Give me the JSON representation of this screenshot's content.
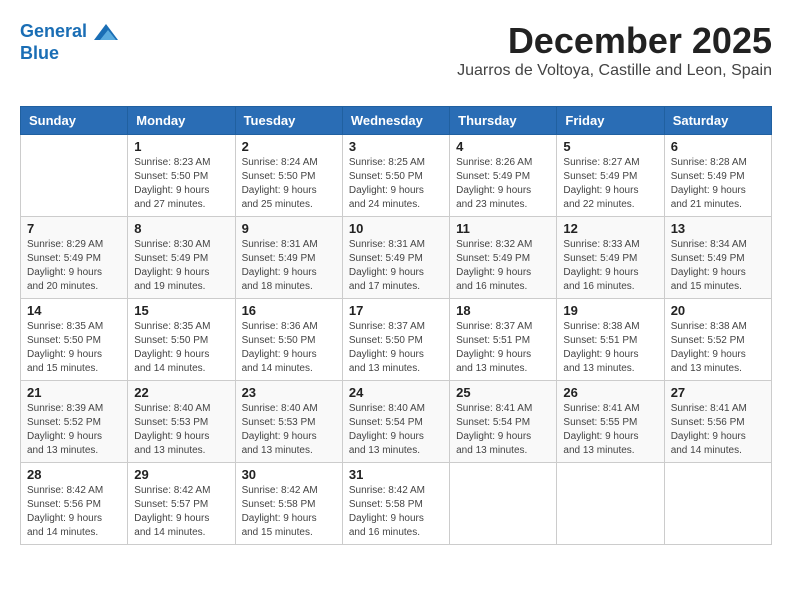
{
  "header": {
    "logo_line1": "General",
    "logo_line2": "Blue",
    "month_title": "December 2025",
    "subtitle": "Juarros de Voltoya, Castille and Leon, Spain"
  },
  "weekdays": [
    "Sunday",
    "Monday",
    "Tuesday",
    "Wednesday",
    "Thursday",
    "Friday",
    "Saturday"
  ],
  "weeks": [
    [
      {
        "day": "",
        "info": ""
      },
      {
        "day": "1",
        "info": "Sunrise: 8:23 AM\nSunset: 5:50 PM\nDaylight: 9 hours\nand 27 minutes."
      },
      {
        "day": "2",
        "info": "Sunrise: 8:24 AM\nSunset: 5:50 PM\nDaylight: 9 hours\nand 25 minutes."
      },
      {
        "day": "3",
        "info": "Sunrise: 8:25 AM\nSunset: 5:50 PM\nDaylight: 9 hours\nand 24 minutes."
      },
      {
        "day": "4",
        "info": "Sunrise: 8:26 AM\nSunset: 5:49 PM\nDaylight: 9 hours\nand 23 minutes."
      },
      {
        "day": "5",
        "info": "Sunrise: 8:27 AM\nSunset: 5:49 PM\nDaylight: 9 hours\nand 22 minutes."
      },
      {
        "day": "6",
        "info": "Sunrise: 8:28 AM\nSunset: 5:49 PM\nDaylight: 9 hours\nand 21 minutes."
      }
    ],
    [
      {
        "day": "7",
        "info": "Sunrise: 8:29 AM\nSunset: 5:49 PM\nDaylight: 9 hours\nand 20 minutes."
      },
      {
        "day": "8",
        "info": "Sunrise: 8:30 AM\nSunset: 5:49 PM\nDaylight: 9 hours\nand 19 minutes."
      },
      {
        "day": "9",
        "info": "Sunrise: 8:31 AM\nSunset: 5:49 PM\nDaylight: 9 hours\nand 18 minutes."
      },
      {
        "day": "10",
        "info": "Sunrise: 8:31 AM\nSunset: 5:49 PM\nDaylight: 9 hours\nand 17 minutes."
      },
      {
        "day": "11",
        "info": "Sunrise: 8:32 AM\nSunset: 5:49 PM\nDaylight: 9 hours\nand 16 minutes."
      },
      {
        "day": "12",
        "info": "Sunrise: 8:33 AM\nSunset: 5:49 PM\nDaylight: 9 hours\nand 16 minutes."
      },
      {
        "day": "13",
        "info": "Sunrise: 8:34 AM\nSunset: 5:49 PM\nDaylight: 9 hours\nand 15 minutes."
      }
    ],
    [
      {
        "day": "14",
        "info": "Sunrise: 8:35 AM\nSunset: 5:50 PM\nDaylight: 9 hours\nand 15 minutes."
      },
      {
        "day": "15",
        "info": "Sunrise: 8:35 AM\nSunset: 5:50 PM\nDaylight: 9 hours\nand 14 minutes."
      },
      {
        "day": "16",
        "info": "Sunrise: 8:36 AM\nSunset: 5:50 PM\nDaylight: 9 hours\nand 14 minutes."
      },
      {
        "day": "17",
        "info": "Sunrise: 8:37 AM\nSunset: 5:50 PM\nDaylight: 9 hours\nand 13 minutes."
      },
      {
        "day": "18",
        "info": "Sunrise: 8:37 AM\nSunset: 5:51 PM\nDaylight: 9 hours\nand 13 minutes."
      },
      {
        "day": "19",
        "info": "Sunrise: 8:38 AM\nSunset: 5:51 PM\nDaylight: 9 hours\nand 13 minutes."
      },
      {
        "day": "20",
        "info": "Sunrise: 8:38 AM\nSunset: 5:52 PM\nDaylight: 9 hours\nand 13 minutes."
      }
    ],
    [
      {
        "day": "21",
        "info": "Sunrise: 8:39 AM\nSunset: 5:52 PM\nDaylight: 9 hours\nand 13 minutes."
      },
      {
        "day": "22",
        "info": "Sunrise: 8:40 AM\nSunset: 5:53 PM\nDaylight: 9 hours\nand 13 minutes."
      },
      {
        "day": "23",
        "info": "Sunrise: 8:40 AM\nSunset: 5:53 PM\nDaylight: 9 hours\nand 13 minutes."
      },
      {
        "day": "24",
        "info": "Sunrise: 8:40 AM\nSunset: 5:54 PM\nDaylight: 9 hours\nand 13 minutes."
      },
      {
        "day": "25",
        "info": "Sunrise: 8:41 AM\nSunset: 5:54 PM\nDaylight: 9 hours\nand 13 minutes."
      },
      {
        "day": "26",
        "info": "Sunrise: 8:41 AM\nSunset: 5:55 PM\nDaylight: 9 hours\nand 13 minutes."
      },
      {
        "day": "27",
        "info": "Sunrise: 8:41 AM\nSunset: 5:56 PM\nDaylight: 9 hours\nand 14 minutes."
      }
    ],
    [
      {
        "day": "28",
        "info": "Sunrise: 8:42 AM\nSunset: 5:56 PM\nDaylight: 9 hours\nand 14 minutes."
      },
      {
        "day": "29",
        "info": "Sunrise: 8:42 AM\nSunset: 5:57 PM\nDaylight: 9 hours\nand 14 minutes."
      },
      {
        "day": "30",
        "info": "Sunrise: 8:42 AM\nSunset: 5:58 PM\nDaylight: 9 hours\nand 15 minutes."
      },
      {
        "day": "31",
        "info": "Sunrise: 8:42 AM\nSunset: 5:58 PM\nDaylight: 9 hours\nand 16 minutes."
      },
      {
        "day": "",
        "info": ""
      },
      {
        "day": "",
        "info": ""
      },
      {
        "day": "",
        "info": ""
      }
    ]
  ]
}
